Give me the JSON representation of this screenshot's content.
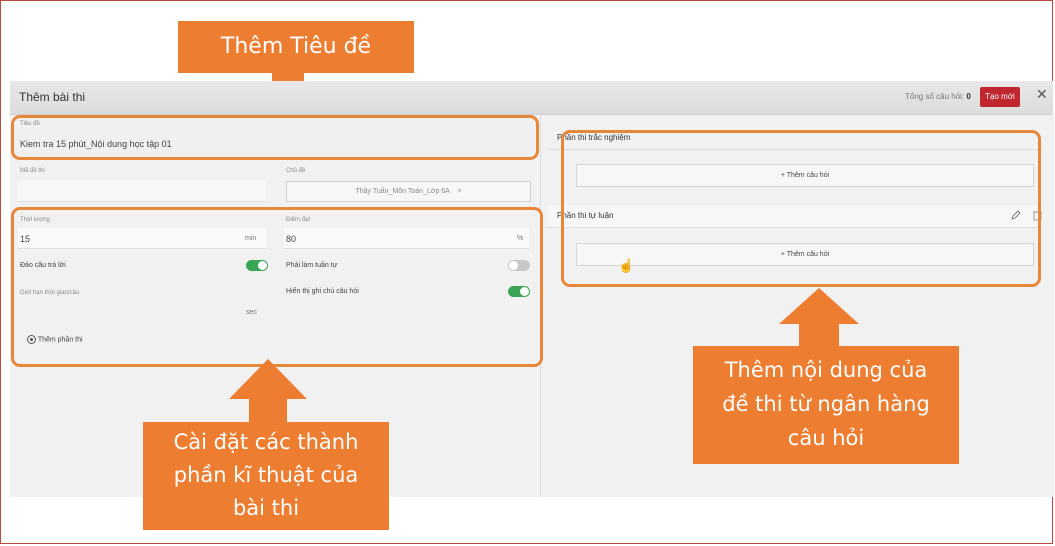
{
  "app": {
    "title": "Thêm bài thi",
    "total_label": "Tổng số câu hỏi:",
    "total_value": "0",
    "create_button": "Tạo mới",
    "close_glyph": "✕"
  },
  "form": {
    "title_label": "Tiêu đề",
    "title_value": "Kiem tra 15 phút_Nội dung học tập 01",
    "code_label": "Mã đề thi",
    "topic_label": "Chủ đề",
    "topic_value": "Thầy Tuấn_Môn Toán_Lớp 6A",
    "topic_chevron": ">",
    "duration_label": "Thời lượng",
    "duration_value": "15",
    "duration_unit": "min",
    "pass_label": "Điểm đạt",
    "pass_value": "80",
    "pass_unit": "%",
    "shuffle_label": "Đảo câu trả lời",
    "sequential_label": "Phải làm tuần tự",
    "limit_label": "Giới hạn thời gian/câu",
    "show_note_label": "Hiển thị ghi chú câu hỏi",
    "limit_unit": "sec",
    "add_section": "Thêm phần thi"
  },
  "toggles": {
    "shuffle": true,
    "sequential": false,
    "show_note": true
  },
  "sections": [
    {
      "title": "Phần thi trắc nghiệm",
      "add_label": "+ Thêm câu hỏi"
    },
    {
      "title": "Phần thi tự luận",
      "add_label": "+ Thêm câu hỏi"
    }
  ],
  "callouts": {
    "top": "Thêm Tiêu đề",
    "bottom_left": [
      "Cài đặt các thành",
      "phần kĩ thuật của",
      "bài thi"
    ],
    "right": [
      "Thêm nội dung của",
      "đề thi từ ngân hàng",
      "câu hỏi"
    ]
  },
  "colors": {
    "accent": "#ed7d31",
    "highlight": "#e6873a",
    "create_button": "#c0262d",
    "toggle_on": "#3aa655"
  }
}
